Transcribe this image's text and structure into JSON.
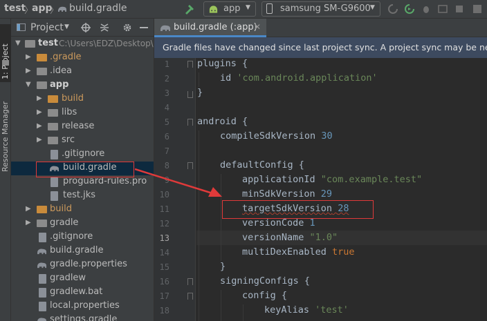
{
  "navbar": {
    "project": "test",
    "module": "app",
    "file": "build.gradle",
    "run_config": "app",
    "device": "samsung SM-G9600"
  },
  "left_stripe": {
    "project_tab": "1: Project",
    "resource_tab": "Resource Manager"
  },
  "project_panel": {
    "view_label": "Project",
    "rows": [
      {
        "label": "test",
        "path": "C:\\Users\\EDZ\\Desktop\\"
      },
      {
        "label": ".gradle"
      },
      {
        "label": ".idea"
      },
      {
        "label": "app"
      },
      {
        "label": "build"
      },
      {
        "label": "libs"
      },
      {
        "label": "release"
      },
      {
        "label": "src"
      },
      {
        "label": ".gitignore"
      },
      {
        "label": "build.gradle"
      },
      {
        "label": "proguard-rules.pro"
      },
      {
        "label": "test.jks"
      },
      {
        "label": "build"
      },
      {
        "label": "gradle"
      },
      {
        "label": ".gitignore"
      },
      {
        "label": "build.gradle"
      },
      {
        "label": "gradle.properties"
      },
      {
        "label": "gradlew"
      },
      {
        "label": "gradlew.bat"
      },
      {
        "label": "local.properties"
      },
      {
        "label": "settings.gradle"
      }
    ]
  },
  "editor": {
    "tab_label": "build.gradle (:app)",
    "banner": "Gradle files have changed since last project sync. A project sync may be necessary",
    "line_numbers": [
      "1",
      "2",
      "3",
      "4",
      "5",
      "6",
      "7",
      "8",
      "9",
      "10",
      "11",
      "12",
      "13",
      "14",
      "15",
      "16",
      "17",
      "18"
    ],
    "current_line": "13",
    "code": {
      "l1": "plugins {",
      "l2_key": "id ",
      "l2_val": "'com.android.application'",
      "l3": "}",
      "l5": "android {",
      "l6_key": "compileSdkVersion ",
      "l6_val": "30",
      "l8": "defaultConfig {",
      "l9_key": "applicationId ",
      "l9_val": "\"com.example.test\"",
      "l10_key": "minSdkVersion ",
      "l10_val": "29",
      "l11_key": "targetSdkVersion",
      "l11_val": "28",
      "l12_key": "versionCode ",
      "l12_val": "1",
      "l13_key": "versionName ",
      "l13_val": "\"1.0\"",
      "l14_key": "multiDexEnabled ",
      "l14_val": "true",
      "l15": "}",
      "l16": "signingConfigs {",
      "l17": "config {",
      "l18_key": "keyAlias ",
      "l18_val": "'test'"
    }
  },
  "colors": {
    "annotation": "#e03a3a",
    "keyword": "#cc7832",
    "string": "#6a8759",
    "number": "#6897bb"
  }
}
